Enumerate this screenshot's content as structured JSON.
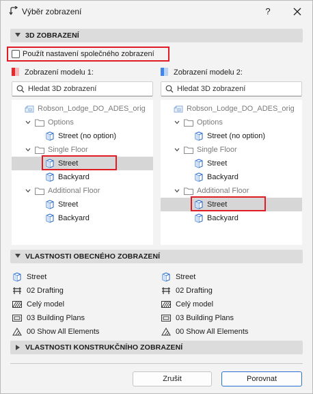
{
  "window": {
    "title": "Výběr zobrazení",
    "help_label": "?"
  },
  "section_3d": {
    "label": "3D ZOBRAZENÍ"
  },
  "shared_view_checkbox": {
    "label": "Použít nastavení společného zobrazení",
    "checked": false
  },
  "model1": {
    "header": "Zobrazení modelu 1:",
    "swatch_color": "#e8262c",
    "search_placeholder": "Hledat 3D zobrazení",
    "tree": [
      {
        "label": "Robson_Lodge_DO_ADES_orig",
        "icon": "project-icon",
        "dim": true
      },
      {
        "label": "Options",
        "icon": "folder-icon",
        "dim": true
      },
      {
        "label": "Street (no option)",
        "icon": "view-3d-icon",
        "dim": false
      },
      {
        "label": "Single Floor",
        "icon": "folder-icon",
        "dim": true
      },
      {
        "label": "Street",
        "icon": "view-3d-icon",
        "dim": false,
        "selected": true
      },
      {
        "label": "Backyard",
        "icon": "view-3d-icon",
        "dim": false
      },
      {
        "label": "Additional Floor",
        "icon": "folder-icon",
        "dim": true
      },
      {
        "label": "Street",
        "icon": "view-3d-icon",
        "dim": false
      },
      {
        "label": "Backyard",
        "icon": "view-3d-icon",
        "dim": false
      }
    ]
  },
  "model2": {
    "header": "Zobrazení modelu 2:",
    "swatch_color": "#3f86e8",
    "search_placeholder": "Hledat 3D zobrazení",
    "tree": [
      {
        "label": "Robson_Lodge_DO_ADES_orig",
        "icon": "project-icon",
        "dim": true
      },
      {
        "label": "Options",
        "icon": "folder-icon",
        "dim": true
      },
      {
        "label": "Street (no option)",
        "icon": "view-3d-icon",
        "dim": false
      },
      {
        "label": "Single Floor",
        "icon": "folder-icon",
        "dim": true
      },
      {
        "label": "Street",
        "icon": "view-3d-icon",
        "dim": false
      },
      {
        "label": "Backyard",
        "icon": "view-3d-icon",
        "dim": false
      },
      {
        "label": "Additional Floor",
        "icon": "folder-icon",
        "dim": true
      },
      {
        "label": "Street",
        "icon": "view-3d-icon",
        "dim": false,
        "selected": true
      },
      {
        "label": "Backyard",
        "icon": "view-3d-icon",
        "dim": false
      }
    ]
  },
  "section_general": {
    "label": "VLASTNOSTI OBECNÉHO ZOBRAZENÍ"
  },
  "general_props_1": [
    "Street",
    "02 Drafting",
    "Celý model",
    "03 Building Plans",
    "00 Show All Elements"
  ],
  "general_props_2": [
    "Street",
    "02 Drafting",
    "Celý model",
    "03 Building Plans",
    "00 Show All Elements"
  ],
  "section_construction": {
    "label": "VLASTNOSTI KONSTRUKČNÍHO ZOBRAZENÍ"
  },
  "buttons": {
    "cancel": "Zrušit",
    "compare": "Porovnat"
  },
  "colors": {
    "highlight": "#e01b24",
    "accent_blue": "#2a6fd1",
    "selection": "#d6d6d6"
  }
}
